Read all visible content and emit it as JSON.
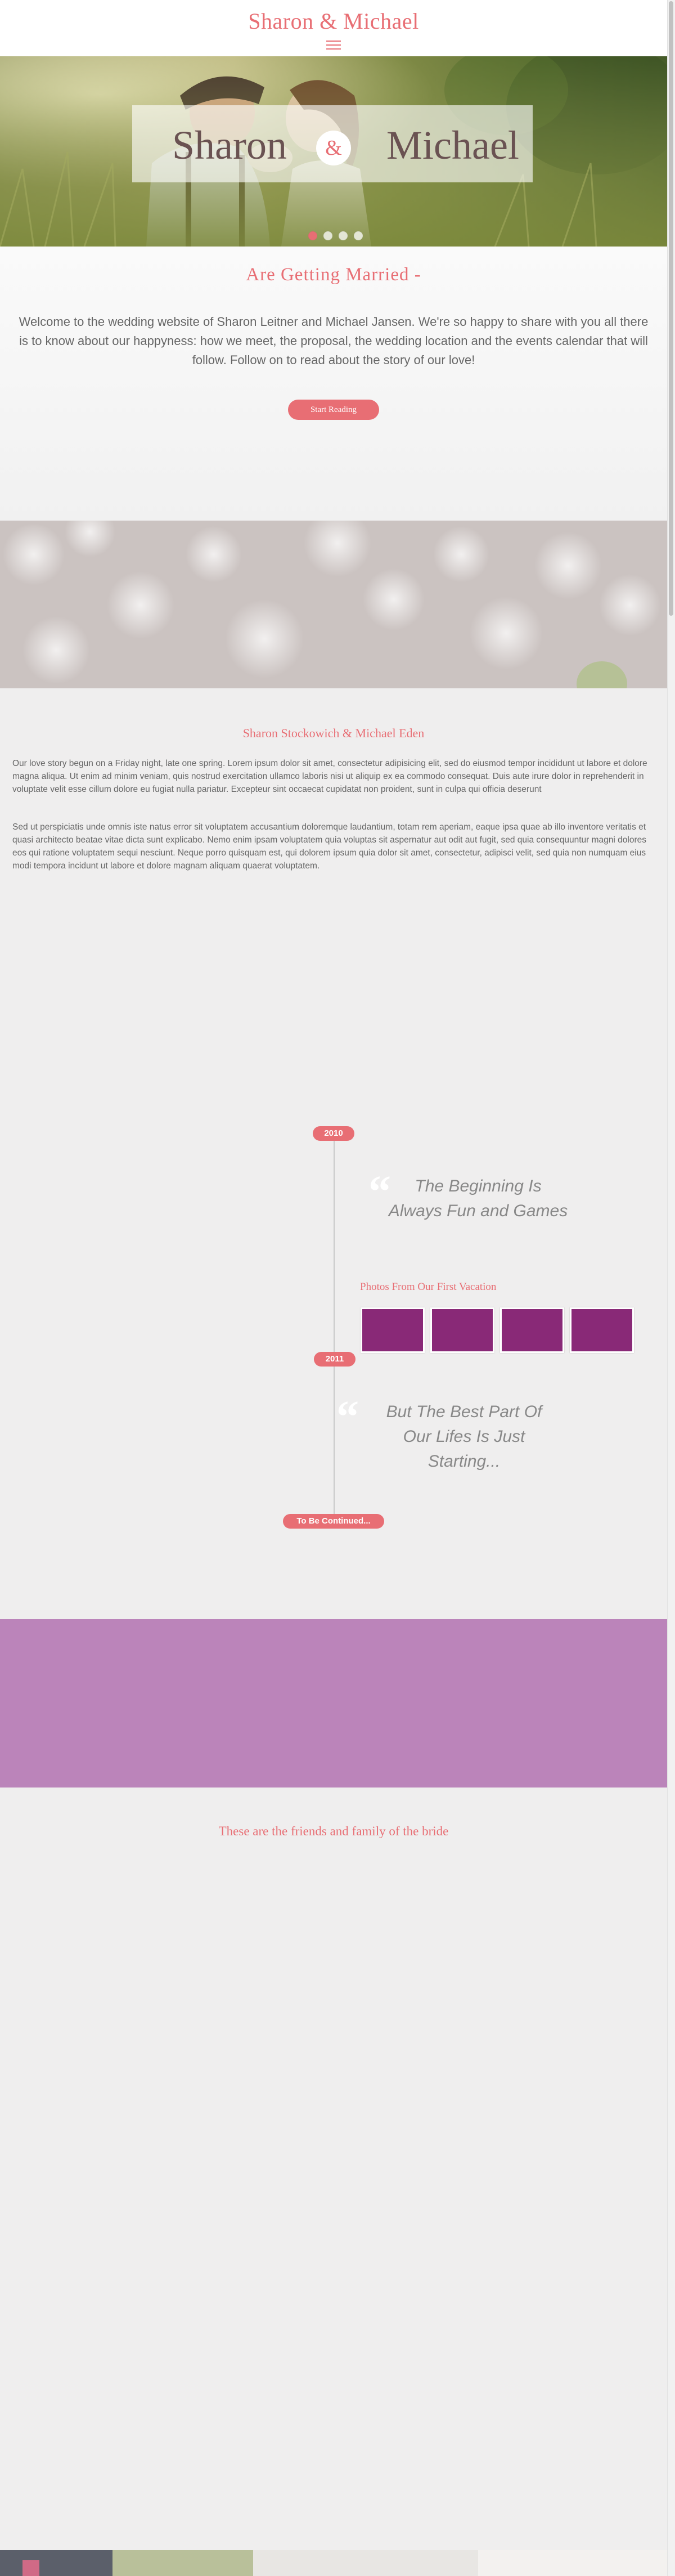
{
  "header": {
    "title": "Sharon & Michael",
    "menu_icon": "hamburger-icon"
  },
  "hero": {
    "name_left": "Sharon",
    "ampersand": "&",
    "name_right": "Michael",
    "slide_count": 4,
    "active_slide": 1
  },
  "intro": {
    "heading": "Are Getting Married -",
    "text": "Welcome to the wedding website of Sharon Leitner and Michael Jansen. We're so happy to share with you all there is to know about our happyness: how we meet, the proposal, the wedding location and the events calendar that will follow. Follow on to read about the story of our love!",
    "button_label": "Start Reading"
  },
  "story": {
    "heading": "Sharon Stockowich & Michael Eden",
    "paragraphs": [
      "Our love story begun on a Friday night, late one spring. Lorem ipsum dolor sit amet, consectetur adipisicing elit, sed do eiusmod tempor incididunt ut labore et dolore magna aliqua. Ut enim ad minim veniam, quis nostrud exercitation ullamco laboris nisi ut aliquip ex ea commodo consequat. Duis aute irure dolor in reprehenderit in voluptate velit esse cillum dolore eu fugiat nulla pariatur. Excepteur sint occaecat cupidatat non proident, sunt in culpa qui officia deserunt",
      "Sed ut perspiciatis unde omnis iste natus error sit voluptatem accusantium doloremque laudantium, totam rem aperiam, eaque ipsa quae ab illo inventore veritatis et quasi architecto beatae vitae dicta sunt explicabo. Nemo enim ipsam voluptatem quia voluptas sit aspernatur aut odit aut fugit, sed quia consequuntur magni dolores eos qui ratione voluptatem sequi nesciunt. Neque porro quisquam est, qui dolorem ipsum quia dolor sit amet, consectetur, adipisci velit, sed quia non numquam eius modi tempora incidunt ut labore et dolore magnam aliquam quaerat voluptatem."
    ]
  },
  "timeline": {
    "year_1": "2010",
    "quote_1": "The Beginning Is Always Fun and Games",
    "photos_heading": "Photos From Our First Vacation",
    "photo_count": 4,
    "photo_color": "#892977",
    "year_2": "2011",
    "quote_2": "But The Best Part Of Our Lifes Is Just Starting...",
    "continued_label": "To Be Continued..."
  },
  "friends": {
    "heading": "These are the friends and family of the bride"
  },
  "colors": {
    "accent": "#e86e74",
    "purple_band": "#bb84ba",
    "background": "#efeeee",
    "name_text": "#6a5252"
  }
}
